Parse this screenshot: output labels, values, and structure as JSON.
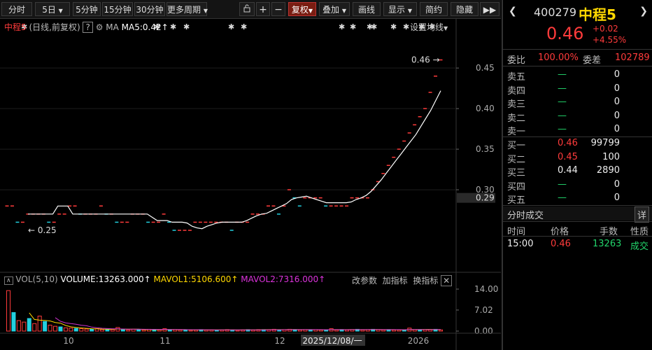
{
  "toolbar": {
    "period_tabs": [
      "分时",
      "5日",
      "5分钟",
      "15分钟",
      "30分钟",
      "更多周期"
    ],
    "tools": [
      "复权",
      "叠加",
      "画线",
      "显示",
      "简约",
      "隐藏"
    ],
    "icons": [
      "lock-icon",
      "plus-icon",
      "minus-icon"
    ]
  },
  "chart": {
    "info_name": "中程5",
    "info_mode": "(日线,前复权)",
    "help_label": "?",
    "ma_label": "MA",
    "ma5_label": "MA5:0.42",
    "ma5_arrow": "↑",
    "settings_label": "设置均线",
    "max_price_label": "0.46",
    "min_price_label": "0.25",
    "price_ticks": [
      "0.45",
      "0.40",
      "0.35",
      "0.30"
    ],
    "current_price_tag": "0.29",
    "price_range": [
      0.2,
      0.495
    ],
    "dates": [
      "10",
      "11",
      "12",
      "2025/12/08/一",
      "2026"
    ],
    "candles": [
      0.28,
      0.28,
      0.26,
      0.26,
      0.27,
      0.27,
      0.27,
      0.27,
      0.26,
      0.26,
      0.27,
      0.27,
      0.28,
      0.28,
      0.27,
      0.27,
      0.27,
      0.27,
      0.28,
      0.27,
      0.27,
      0.26,
      0.26,
      0.26,
      0.27,
      0.27,
      0.27,
      0.26,
      0.26,
      0.26,
      0.27,
      0.26,
      0.25,
      0.25,
      0.25,
      0.25,
      0.26,
      0.26,
      0.26,
      0.26,
      0.26,
      0.26,
      0.26,
      0.25,
      0.26,
      0.26,
      0.26,
      0.27,
      0.27,
      0.27,
      0.28,
      0.28,
      0.27,
      0.28,
      0.3,
      0.29,
      0.28,
      0.29,
      0.29,
      0.29,
      0.29,
      0.28,
      0.28,
      0.28,
      0.28,
      0.28,
      0.29,
      0.29,
      0.29,
      0.29,
      0.3,
      0.31,
      0.32,
      0.33,
      0.34,
      0.35,
      0.36,
      0.37,
      0.38,
      0.39,
      0.4,
      0.42,
      0.44,
      0.46
    ],
    "ma5": [
      0.27,
      0.27,
      0.27,
      0.27,
      0.27,
      0.27,
      0.28,
      0.28,
      0.28,
      0.27,
      0.27,
      0.27,
      0.27,
      0.27,
      0.27,
      0.27,
      0.27,
      0.27,
      0.27,
      0.27,
      0.27,
      0.27,
      0.27,
      0.27,
      0.27,
      0.266,
      0.262,
      0.262,
      0.262,
      0.26,
      0.26,
      0.26,
      0.259,
      0.255,
      0.253,
      0.252,
      0.255,
      0.257,
      0.259,
      0.26,
      0.26,
      0.26,
      0.26,
      0.26,
      0.262,
      0.265,
      0.268,
      0.27,
      0.271,
      0.274,
      0.277,
      0.28,
      0.283,
      0.288,
      0.29,
      0.291,
      0.292,
      0.29,
      0.288,
      0.286,
      0.284,
      0.284,
      0.284,
      0.284,
      0.284,
      0.285,
      0.288,
      0.29,
      0.293,
      0.298,
      0.305,
      0.312,
      0.32,
      0.328,
      0.336,
      0.344,
      0.352,
      0.36,
      0.368,
      0.378,
      0.388,
      0.398,
      0.41,
      0.422
    ]
  },
  "volume": {
    "label": "VOL(5,10)",
    "volume": "VOLUME:13263.000",
    "mavol1": "MAVOL1:5106.600",
    "mavol2": "MAVOL2:7316.000",
    "arrow": "↑",
    "actions": [
      "改参数",
      "加指标",
      "换指标"
    ],
    "ticks": [
      "14.00",
      "7.02",
      "0.00"
    ],
    "max": 14.0,
    "bars": [
      13.5,
      6.2,
      3.5,
      3.0,
      4.2,
      2.5,
      5.0,
      3.2,
      2.0,
      1.6,
      1.4,
      1.1,
      1.0,
      0.9,
      0.8,
      0.7,
      0.6,
      0.8,
      0.5,
      0.6,
      0.5,
      1.2,
      0.5,
      0.4,
      0.6,
      0.5,
      0.4,
      0.6,
      0.5,
      0.4,
      0.8,
      0.4,
      0.5,
      0.4,
      0.4,
      0.3,
      0.4,
      0.5,
      0.4,
      0.4,
      0.3,
      0.4,
      0.5,
      0.4,
      0.3,
      0.4,
      0.5,
      0.4,
      0.5,
      0.5,
      0.5,
      0.6,
      0.4,
      0.5,
      0.6,
      0.5,
      0.4,
      0.5,
      0.4,
      0.5,
      0.4,
      0.4,
      0.8,
      0.4,
      0.5,
      0.4,
      0.5,
      0.6,
      0.4,
      0.5,
      0.6,
      0.5,
      0.4,
      0.5,
      0.4,
      0.4,
      0.4,
      1.0,
      0.5,
      0.4,
      0.5,
      0.5,
      0.6,
      0.4
    ]
  },
  "quote": {
    "code": "400279",
    "name": "中程5",
    "price": "0.46",
    "change": "+0.02",
    "change_pct": "+4.55%",
    "webi_label": "委比",
    "webi_value": "100.00%",
    "weicha_label": "委差",
    "weicha_value": "102789",
    "asks": [
      {
        "label": "卖五",
        "price": "—",
        "vol": "0"
      },
      {
        "label": "卖四",
        "price": "—",
        "vol": "0"
      },
      {
        "label": "卖三",
        "price": "—",
        "vol": "0"
      },
      {
        "label": "卖二",
        "price": "—",
        "vol": "0"
      },
      {
        "label": "卖一",
        "price": "—",
        "vol": "0"
      }
    ],
    "bids": [
      {
        "label": "买一",
        "price": "0.46",
        "vol": "99799"
      },
      {
        "label": "买二",
        "price": "0.45",
        "vol": "100"
      },
      {
        "label": "买三",
        "price": "0.44",
        "vol": "2890"
      },
      {
        "label": "买四",
        "price": "—",
        "vol": "0"
      },
      {
        "label": "买五",
        "price": "—",
        "vol": "0"
      }
    ],
    "trades_title": "分时成交",
    "detail_button": "详",
    "trade_headers": [
      "时间",
      "价格",
      "手数",
      "性质"
    ],
    "trades": [
      {
        "time": "15:00",
        "price": "0.46",
        "vol": "13263",
        "kind": "成交"
      }
    ]
  },
  "colors": {
    "up": "#ff3b3b",
    "down": "#22d0e0",
    "ma5": "#ffffff",
    "accent": "#ffd800",
    "purple": "#cc33cc"
  }
}
